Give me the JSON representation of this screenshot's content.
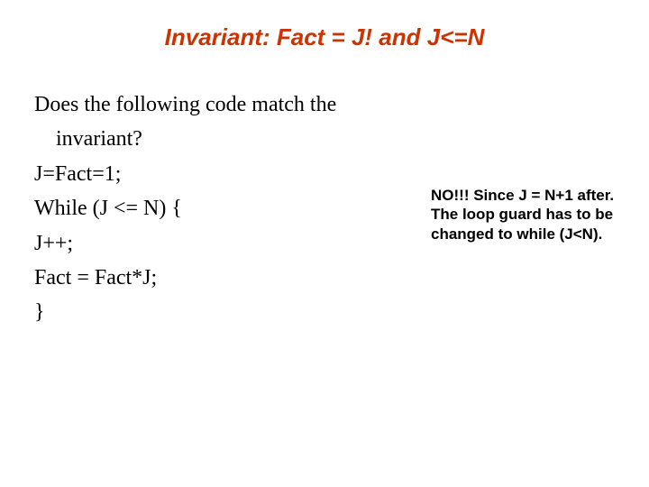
{
  "title": "Invariant: Fact = J! and J<=N",
  "body": {
    "question_l1": "Does the following code match the",
    "question_l2": "invariant?",
    "code": {
      "l1": "J=Fact=1;",
      "l2": "While (J <= N) {",
      "l3": "J++;",
      "l4": "Fact = Fact*J;",
      "l5": "}"
    }
  },
  "note": "NO!!! Since J = N+1 after. The loop guard has to be changed to while (J<N)."
}
